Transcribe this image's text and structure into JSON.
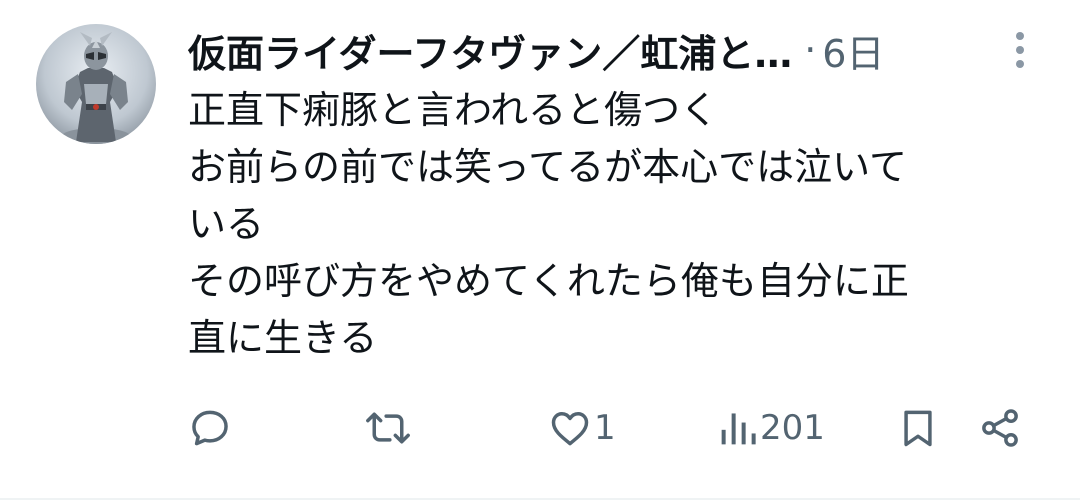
{
  "tweet": {
    "author_name": "仮面ライダーフタヴァン／虹浦と…",
    "separator": "·",
    "time": "6日",
    "text_lines": [
      "正直下痢豚と言われると傷つく",
      "お前らの前では笑ってるが本心では泣いて",
      "いる",
      "その呼び方をやめてくれたら俺も自分に正",
      "直に生きる"
    ],
    "actions": {
      "reply": {
        "icon": "reply-icon",
        "count": ""
      },
      "retweet": {
        "icon": "retweet-icon",
        "count": ""
      },
      "like": {
        "icon": "heart-icon",
        "count": "1"
      },
      "views": {
        "icon": "views-icon",
        "count": "201"
      },
      "bookmark": {
        "icon": "bookmark-icon"
      },
      "share": {
        "icon": "share-icon"
      }
    }
  },
  "colors": {
    "text": "#0f1419",
    "secondary": "#536471",
    "divider": "#eff3f4"
  }
}
